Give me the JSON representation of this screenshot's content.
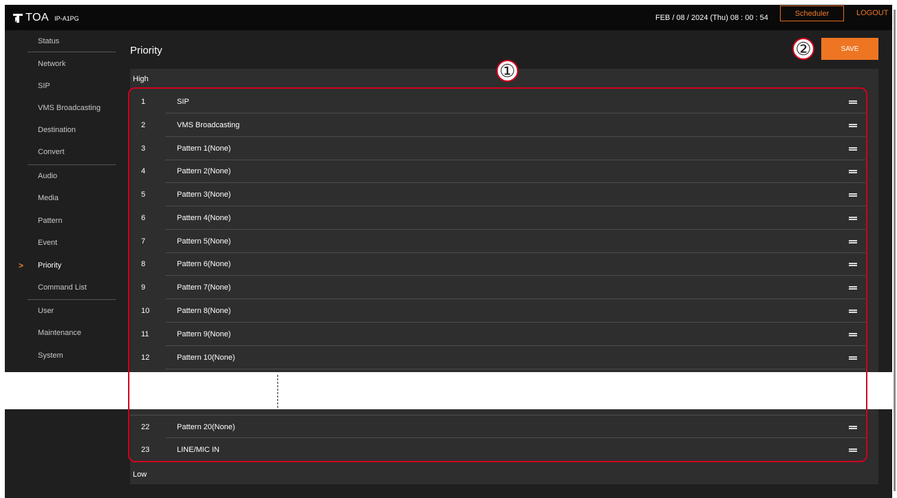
{
  "header": {
    "brand": "TOA",
    "model": "IP-A1PG",
    "datetime": "FEB / 08 / 2024 (Thu)   08 : 00 : 54",
    "scheduler_label": "Scheduler",
    "logout_label": "LOGOUT"
  },
  "sidebar": {
    "items": [
      {
        "label": "Status"
      },
      {
        "label": "Network"
      },
      {
        "label": "SIP"
      },
      {
        "label": "VMS Broadcasting"
      },
      {
        "label": "Destination"
      },
      {
        "label": "Convert"
      },
      {
        "label": "Audio"
      },
      {
        "label": "Media"
      },
      {
        "label": "Pattern"
      },
      {
        "label": "Event"
      },
      {
        "label": "Priority",
        "active": true
      },
      {
        "label": "Command List"
      },
      {
        "label": "User"
      },
      {
        "label": "Maintenance"
      },
      {
        "label": "System"
      }
    ],
    "active_marker": ">"
  },
  "main": {
    "title": "Priority",
    "save_label": "SAVE",
    "high_label": "High",
    "low_label": "Low",
    "rows": [
      {
        "num": "1",
        "name": "SIP"
      },
      {
        "num": "2",
        "name": "VMS Broadcasting"
      },
      {
        "num": "3",
        "name": "Pattern 1(None)"
      },
      {
        "num": "4",
        "name": "Pattern 2(None)"
      },
      {
        "num": "5",
        "name": "Pattern 3(None)"
      },
      {
        "num": "6",
        "name": "Pattern 4(None)"
      },
      {
        "num": "7",
        "name": "Pattern 5(None)"
      },
      {
        "num": "8",
        "name": "Pattern 6(None)"
      },
      {
        "num": "9",
        "name": "Pattern 7(None)"
      },
      {
        "num": "10",
        "name": "Pattern 8(None)"
      },
      {
        "num": "11",
        "name": "Pattern 9(None)"
      },
      {
        "num": "12",
        "name": "Pattern 10(None)"
      },
      {
        "num": "22",
        "name": "Pattern 20(None)"
      },
      {
        "num": "23",
        "name": "LINE/MIC IN"
      }
    ]
  },
  "callouts": {
    "one": "①",
    "two": "②"
  },
  "colors": {
    "accent": "#ee7623",
    "callout": "#d1021e",
    "background": "#1f1f1f",
    "panel": "#2e2e2e"
  }
}
